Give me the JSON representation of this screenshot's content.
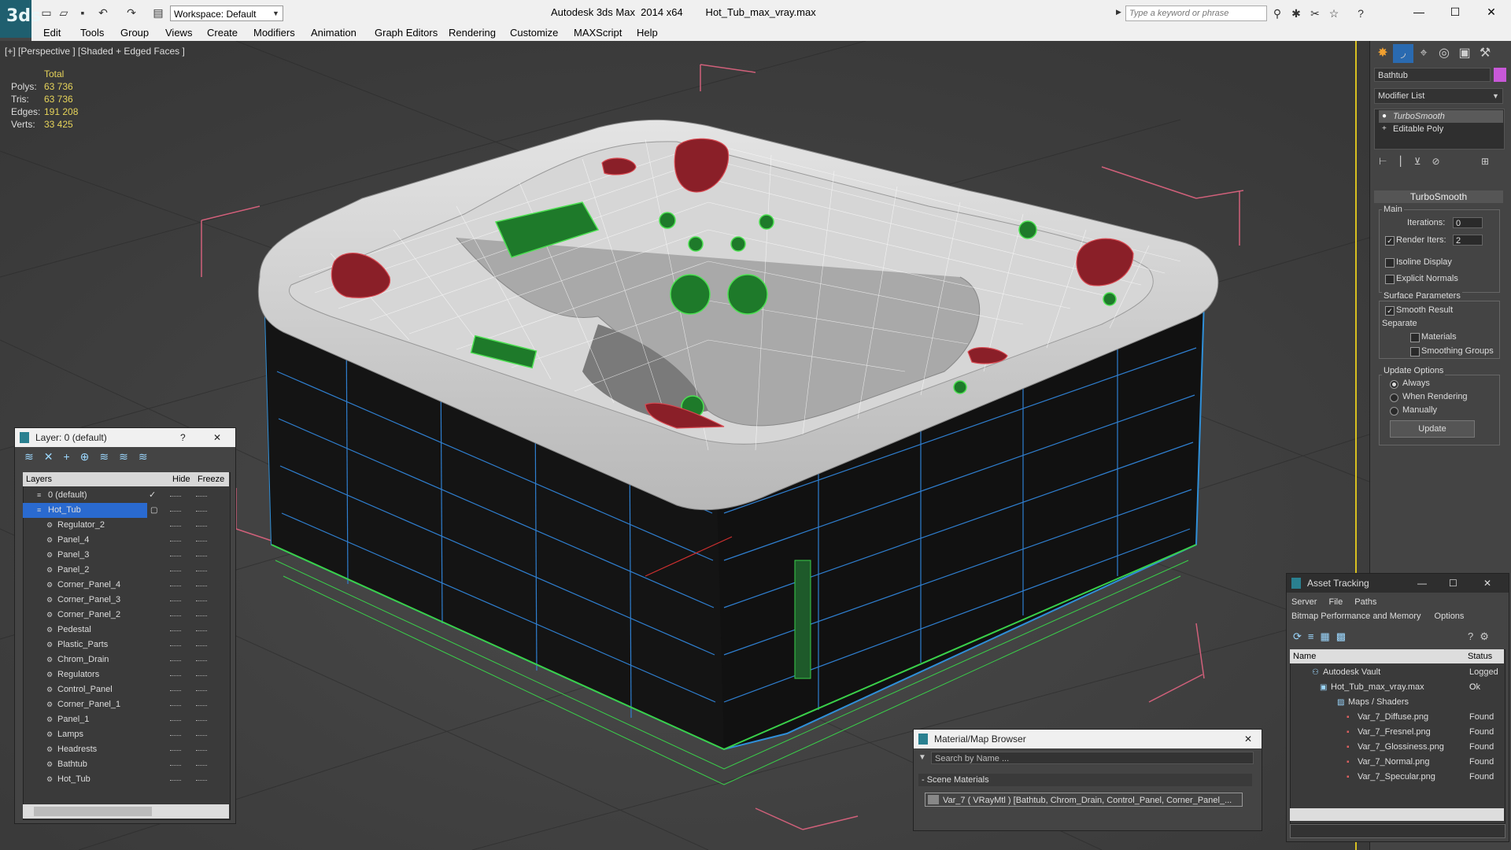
{
  "app": {
    "title": "Autodesk 3ds Max  2014 x64        Hot_Tub_max_vray.max",
    "logo": "3ds"
  },
  "titlebar": {
    "workspace": "Workspace: Default",
    "search_placeholder": "Type a keyword or phrase",
    "window_controls": [
      "—",
      "☐",
      "✕"
    ]
  },
  "menu": [
    "Edit",
    "Tools",
    "Group",
    "Views",
    "Create",
    "Modifiers",
    "Animation",
    "Graph Editors",
    "Rendering",
    "Customize",
    "MAXScript",
    "Help"
  ],
  "viewport": {
    "label": "[+] [Perspective ] [Shaded + Edged Faces ]",
    "stats": {
      "header": "Total",
      "rows": [
        {
          "k": "Polys:",
          "v": "63 736"
        },
        {
          "k": "Tris:",
          "v": "63 736"
        },
        {
          "k": "Edges:",
          "v": "191 208"
        },
        {
          "k": "Verts:",
          "v": "33 425"
        }
      ]
    }
  },
  "command_panel": {
    "object_name": "Bathtub",
    "object_color": "#c858d8",
    "modifier_list": "Modifier List",
    "stack": [
      "TurboSmooth",
      "Editable Poly"
    ],
    "rollout": "TurboSmooth",
    "main_label": "Main",
    "iterations_label": "Iterations:",
    "iterations_value": "0",
    "render_iters_label": "Render Iters:",
    "render_iters_value": "2",
    "isoline": "Isoline Display",
    "explicit_normals": "Explicit Normals",
    "surface_params": "Surface Parameters",
    "smooth_result": "Smooth Result",
    "separate": "Separate",
    "materials": "Materials",
    "smoothing_groups": "Smoothing Groups",
    "update_options": "Update Options",
    "always": "Always",
    "when_rendering": "When Rendering",
    "manually": "Manually",
    "update_button": "Update"
  },
  "layer_window": {
    "title": "Layer: 0 (default)",
    "help": "?",
    "close": "✕",
    "columns": [
      "Layers",
      "Hide",
      "Freeze"
    ],
    "rows": [
      "0 (default)",
      "Hot_Tub",
      "Regulator_2",
      "Panel_4",
      "Panel_3",
      "Panel_2",
      "Corner_Panel_4",
      "Corner_Panel_3",
      "Corner_Panel_2",
      "Pedestal",
      "Plastic_Parts",
      "Chrom_Drain",
      "Regulators",
      "Control_Panel",
      "Corner_Panel_1",
      "Panel_1",
      "Lamps",
      "Headrests",
      "Bathtub",
      "Hot_Tub"
    ]
  },
  "asset_window": {
    "title": "Asset Tracking",
    "menu1": [
      "Server",
      "File",
      "Paths"
    ],
    "menu2": [
      "Bitmap Performance and Memory",
      "Options"
    ],
    "columns": [
      "Name",
      "Status"
    ],
    "rows": [
      {
        "name": "Autodesk Vault",
        "status": "Logged O"
      },
      {
        "name": "Hot_Tub_max_vray.max",
        "status": "Ok"
      },
      {
        "name": "Maps / Shaders",
        "status": ""
      },
      {
        "name": "Var_7_Diffuse.png",
        "status": "Found"
      },
      {
        "name": "Var_7_Fresnel.png",
        "status": "Found"
      },
      {
        "name": "Var_7_Glossiness.png",
        "status": "Found"
      },
      {
        "name": "Var_7_Normal.png",
        "status": "Found"
      },
      {
        "name": "Var_7_Specular.png",
        "status": "Found"
      }
    ]
  },
  "material_window": {
    "title": "Material/Map Browser",
    "search_placeholder": "Search by Name ...",
    "section": "- Scene Materials",
    "entry": "Var_7  ( VRayMtl )  [Bathtub, Chrom_Drain, Control_Panel, Corner_Panel_..."
  }
}
